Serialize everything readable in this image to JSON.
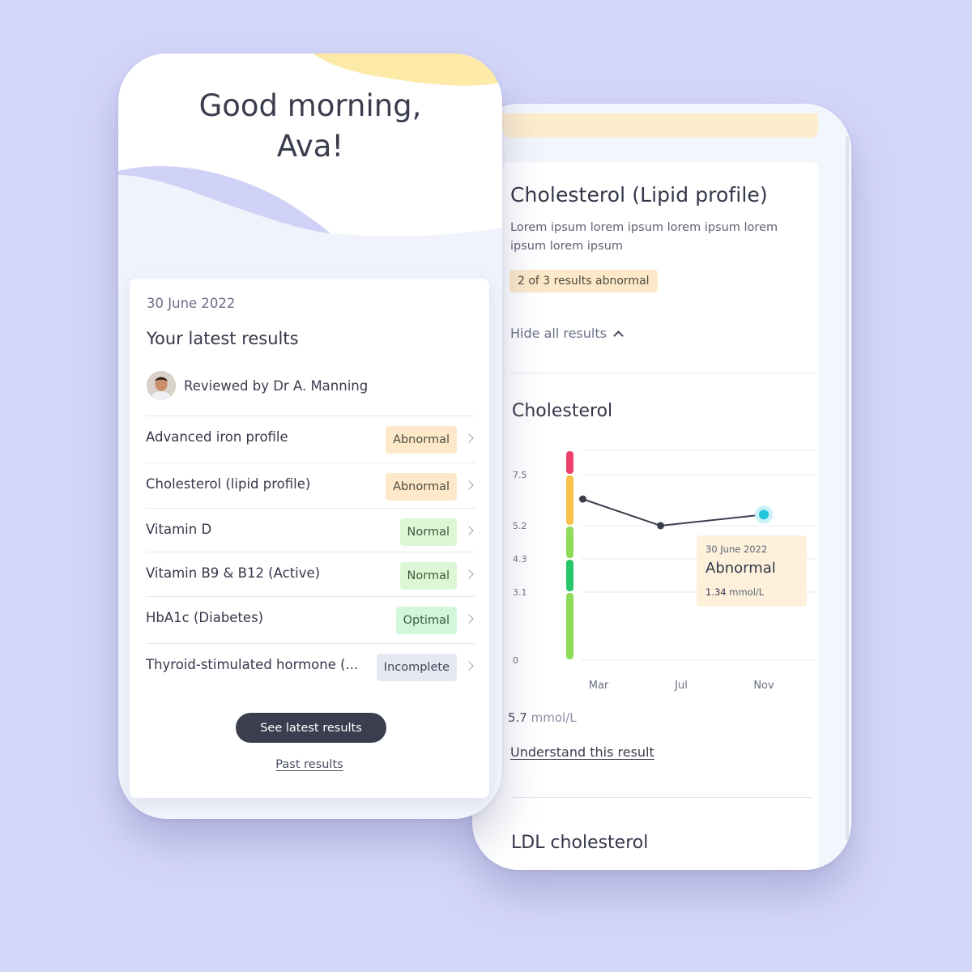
{
  "home": {
    "greeting_line1": "Good morning,",
    "greeting_line2": "Ava!",
    "card": {
      "date": "30 June 2022",
      "title": "Your latest results",
      "reviewer": "Reviewed by Dr A. Manning",
      "rows": [
        {
          "name": "Advanced iron profile",
          "status": "Abnormal"
        },
        {
          "name": "Cholesterol (lipid profile)",
          "status": "Abnormal"
        },
        {
          "name": "Vitamin D",
          "status": "Normal"
        },
        {
          "name": "Vitamin B9 & B12 (Active)",
          "status": "Normal"
        },
        {
          "name": "HbA1c (Diabetes)",
          "status": "Optimal"
        },
        {
          "name": "Thyroid-stimulated hormone (...",
          "status": "Incomplete"
        }
      ],
      "primary_button": "See latest results",
      "secondary_link": "Past results"
    }
  },
  "detail": {
    "title": "Cholesterol (Lipid profile)",
    "description": "Lorem ipsum lorem ipsum lorem ipsum lorem ipsum lorem ipsum",
    "summary_badge": "2 of 3 results abnormal",
    "hide_results": "Hide all results",
    "section_title": "Cholesterol",
    "value_number": "5.7",
    "value_unit": "mmol/L",
    "understand_link": "Understand this result",
    "next_section": "LDL cholesterol",
    "tooltip": {
      "date": "30 June 2022",
      "status": "Abnormal",
      "value": "1.34",
      "unit": "mmol/L"
    }
  },
  "colors": {
    "background": "#d4d6f9",
    "abnormal": "#fde9c9",
    "normal": "#dcf7d6",
    "incomplete": "#e6e8f1",
    "accent_point": "#23c4de",
    "range_red": "#ef3f6b",
    "range_amber": "#f9c04a",
    "range_green_light": "#8fdc5b",
    "range_green": "#26c76a"
  },
  "chart_data": {
    "type": "line",
    "x_ticks": [
      "Mar",
      "Jul",
      "Nov"
    ],
    "y_ticks": [
      0,
      3.1,
      4.3,
      5.2,
      7.5
    ],
    "series": [
      {
        "points": [
          {
            "x": "Feb",
            "y": 6.4
          },
          {
            "x": "Jun",
            "y": 5.2
          },
          {
            "x": "Nov",
            "y": 5.7
          }
        ]
      }
    ],
    "reference_bands": [
      {
        "from": 0,
        "to": 3.1,
        "color": "#8fdc5b"
      },
      {
        "from": 3.1,
        "to": 4.3,
        "color": "#26c76a"
      },
      {
        "from": 4.3,
        "to": 5.2,
        "color": "#8fdc5b"
      },
      {
        "from": 5.2,
        "to": 7.5,
        "color": "#f9c04a"
      },
      {
        "from": 7.5,
        "to": 9.0,
        "color": "#ef3f6b"
      }
    ],
    "highlighted_point": {
      "x": "Nov",
      "y": 5.7
    },
    "grid": true
  }
}
